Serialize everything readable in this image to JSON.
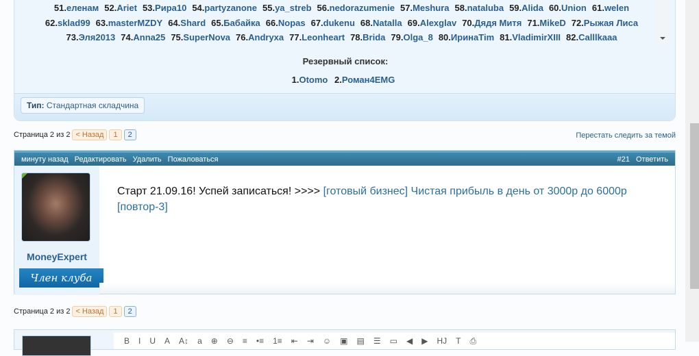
{
  "participants": [
    [
      [
        "51.",
        "еленам"
      ],
      [
        "52.",
        "Ariet"
      ],
      [
        "53.",
        "Рира10"
      ],
      [
        "54.",
        "partyzanone"
      ],
      [
        "55.",
        "ya_streb"
      ],
      [
        "56.",
        "nedorazumenie"
      ],
      [
        "57.",
        "Meshura"
      ],
      [
        "58.",
        "nataluba"
      ],
      [
        "59.",
        "Alida"
      ],
      [
        "60.",
        "Union"
      ],
      [
        "61.",
        "welen"
      ]
    ],
    [
      [
        "62.",
        "sklad99"
      ],
      [
        "63.",
        "masterMZDY"
      ],
      [
        "64.",
        "Shard"
      ],
      [
        "65.",
        "Бабайка"
      ],
      [
        "66.",
        "Nopas"
      ],
      [
        "67.",
        "dukenu"
      ],
      [
        "68.",
        "Natalla"
      ],
      [
        "69.",
        "Alexglav"
      ],
      [
        "70.",
        "Дядя Митя"
      ],
      [
        "71.",
        "MikeD"
      ],
      [
        "72.",
        "Рыжая Лиса"
      ]
    ],
    [
      [
        "73.",
        "Эля2013"
      ],
      [
        "74.",
        "Anna25"
      ],
      [
        "75.",
        "SuperNova"
      ],
      [
        "76.",
        "Andryxa"
      ],
      [
        "77.",
        "Leonheart"
      ],
      [
        "78.",
        "Brida"
      ],
      [
        "79.",
        "Olga_8"
      ],
      [
        "80.",
        "ИринаTim"
      ],
      [
        "81.",
        "VladimirXIII"
      ],
      [
        "82.",
        "Calllkaaa"
      ]
    ]
  ],
  "reserve": {
    "title": "Резервный список:",
    "items": [
      [
        "1.",
        "Otomo"
      ],
      [
        "2.",
        "Роман4EMG"
      ]
    ]
  },
  "type": {
    "label": "Тип:",
    "value": "Стандартная складчина"
  },
  "pager": {
    "text": "Страница 2 из 2",
    "prev": "< Назад",
    "pages": [
      "1",
      "2"
    ]
  },
  "unwatch": "Перестать следить за темой",
  "post": {
    "time": "минуту назад",
    "edit": "Редактировать",
    "delete": "Удалить",
    "report": "Пожаловаться",
    "number": "#21",
    "reply": "Ответить",
    "username": "MoneyExpert",
    "user_title": "Член клуба",
    "text": "Старт 21.09.16! Успей записаться! >>>> ",
    "link": "[готовый бизнес] Чистая прибыль в день от 3000р до 6000р [повтор-3]"
  },
  "toolbar": [
    "B",
    "I",
    "U",
    "A",
    "A↕",
    "a",
    "⊕",
    "⊖",
    "≡",
    "•≡",
    "1≡",
    "⇤",
    "⇥",
    "☺",
    "▣",
    "▤",
    "☰",
    "▭",
    "◀",
    "▶",
    "HJ",
    "T",
    "⎙"
  ]
}
